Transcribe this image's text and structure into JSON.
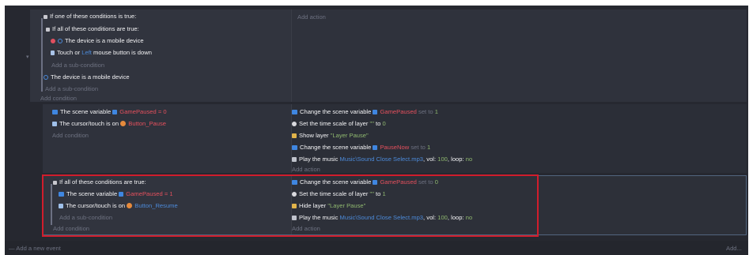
{
  "events": [
    {
      "conditions": {
        "header": "If one of these conditions is true:",
        "sub_header": "If all of these conditions are true:",
        "c1": "The device is a mobile device",
        "c2_a": "Touch or",
        "c2_b": "Left",
        "c2_c": "mouse button is down",
        "add_sub_inner": "Add a sub-condition",
        "c3": "The device is a mobile device",
        "add_sub_outer": "Add a sub-condition",
        "add_condition": "Add condition"
      },
      "actions": {
        "add_action": "Add action"
      }
    },
    {
      "conditions": {
        "c1_a": "The scene variable",
        "c1_var": "GamePaused",
        "c1_b": "= 0",
        "c2_a": "The cursor/touch is on",
        "c2_obj": "Button_Pause",
        "add_condition": "Add condition"
      },
      "actions": {
        "a1_a": "Change the scene variable",
        "a1_var": "GamePaused",
        "a1_b": "set to",
        "a1_val": "1",
        "a2_a": "Set the time scale of layer",
        "a2_layer": "\"\"",
        "a2_b": "to",
        "a2_val": "0",
        "a3_a": "Show layer",
        "a3_layer": "\"Layer Pause\"",
        "a4_a": "Change the scene variable",
        "a4_var": "PauseNow",
        "a4_b": "set to",
        "a4_val": "1",
        "a5_a": "Play the music",
        "a5_file": "Music\\Sound Close Select.mp3",
        "a5_vol": "vol:",
        "a5_volv": "100",
        "a5_loop": "loop:",
        "a5_loopv": "no",
        "add_action": "Add action"
      }
    },
    {
      "conditions": {
        "header": "If all of these conditions are true:",
        "c1_a": "The scene variable",
        "c1_var": "GamePaused",
        "c1_b": "= 1",
        "c2_a": "The cursor/touch is on",
        "c2_obj": "Button_Resume",
        "add_sub": "Add a sub-condition",
        "add_condition": "Add condition"
      },
      "actions": {
        "a1_a": "Change the scene variable",
        "a1_var": "GamePaused",
        "a1_b": "set to",
        "a1_val": "0",
        "a2_a": "Set the time scale of layer",
        "a2_layer": "\"\"",
        "a2_b": "to",
        "a2_val": "1",
        "a3_a": "Hide layer",
        "a3_layer": "\"Layer Pause\"",
        "a4_a": "Play the music",
        "a4_file": "Music\\Sound Close Select.mp3",
        "a4_vol": "vol:",
        "a4_volv": "100",
        "a4_loop": "loop:",
        "a4_loopv": "no",
        "add_action": "Add action"
      }
    }
  ],
  "footer": {
    "add_event": "Add a new event",
    "right_label": "Add..."
  }
}
